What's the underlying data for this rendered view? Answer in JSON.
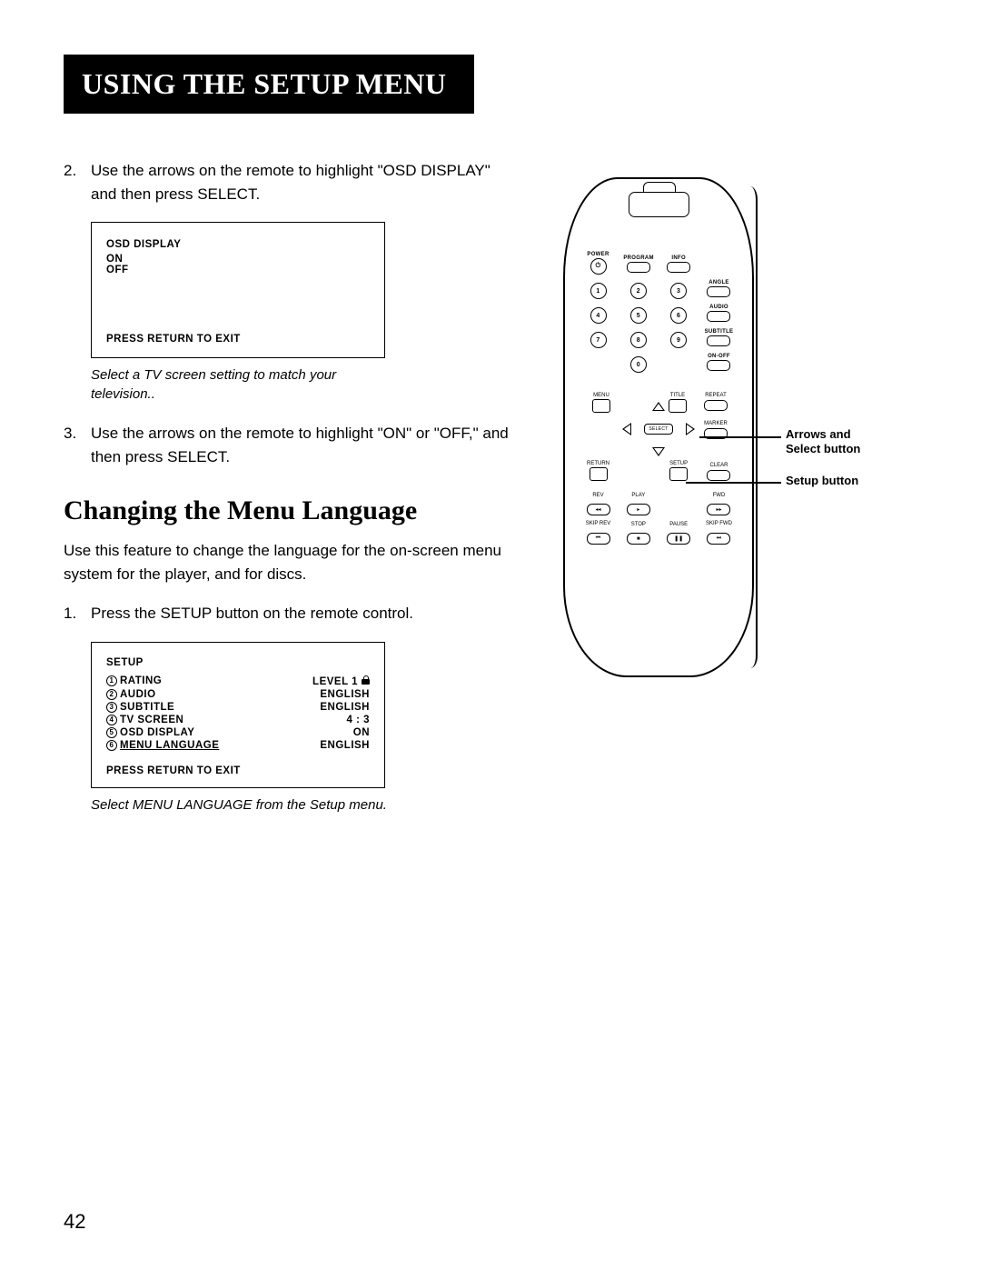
{
  "title": "USING THE SETUP MENU",
  "step2_num": "2.",
  "step2_text": "Use the arrows on the remote to highlight \"OSD DISPLAY\" and then press SELECT.",
  "osd_panel": {
    "title": "OSD DISPLAY",
    "opt_on": "ON",
    "opt_off": "OFF",
    "footer": "PRESS RETURN TO EXIT"
  },
  "caption1": "Select a TV screen setting to match your television..",
  "step3_num": "3.",
  "step3_text": "Use the arrows on the remote to highlight \"ON\" or \"OFF,\" and then press SELECT.",
  "section2": "Changing the Menu Language",
  "para2": "Use this feature to change the language for the on-screen menu system for the player, and for discs.",
  "step1b_num": "1.",
  "step1b_text": "Press the SETUP button on the remote control.",
  "setup_panel": {
    "title": "SETUP",
    "rows": [
      {
        "n": "1",
        "label": "RATING",
        "val": "LEVEL 1",
        "lock": true
      },
      {
        "n": "2",
        "label": "AUDIO",
        "val": "ENGLISH"
      },
      {
        "n": "3",
        "label": "SUBTITLE",
        "val": "ENGLISH"
      },
      {
        "n": "4",
        "label": "TV SCREEN",
        "val": "4 : 3"
      },
      {
        "n": "5",
        "label": "OSD DISPLAY",
        "val": "ON"
      },
      {
        "n": "6",
        "label": "MENU LANGUAGE",
        "val": "ENGLISH",
        "hl": true
      }
    ],
    "footer": "PRESS RETURN TO EXIT"
  },
  "caption2": "Select MENU LANGUAGE from the Setup menu.",
  "page_number": "42",
  "remote": {
    "power": "POWER",
    "program": "PROGRAM",
    "info": "INFO",
    "angle": "ANGLE",
    "audio": "AUDIO",
    "subtitle": "SUBTITLE",
    "onoff": "ON-OFF",
    "menu": "MENU",
    "title": "TITLE",
    "repeat": "REPEAT",
    "marker": "MARKER",
    "select": "SELECT",
    "return": "RETURN",
    "setup": "SETUP",
    "clear": "CLEAR",
    "rev": "REV",
    "play": "PLAY",
    "fwd": "FWD",
    "skip_rev": "SKIP REV",
    "stop": "STOP",
    "pause": "PAUSE",
    "skip_fwd": "SKIP FWD",
    "nums": [
      "1",
      "2",
      "3",
      "4",
      "5",
      "6",
      "7",
      "8",
      "9",
      "0"
    ]
  },
  "callout1": "Arrows and Select button",
  "callout2": "Setup button"
}
